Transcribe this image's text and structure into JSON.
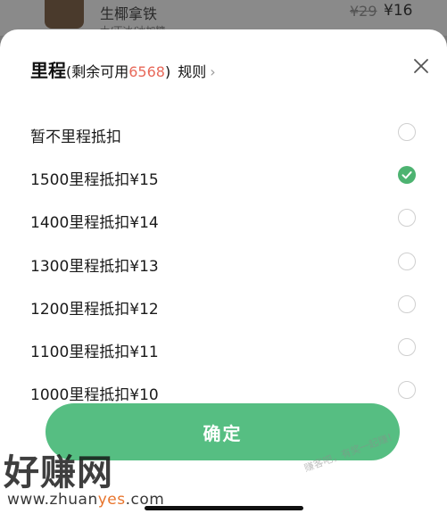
{
  "background_item": {
    "name": "生椰拿铁",
    "subtitle": "大/正冰/冰加糖",
    "original_price": "¥29",
    "price": "¥16"
  },
  "sheet": {
    "title": "里程",
    "remaining_prefix": "(剩余可用",
    "remaining_value": "6568",
    "remaining_suffix": ")",
    "rules_label": "规则",
    "rules_chevron": "›",
    "close_icon": "close-icon",
    "options": [
      {
        "label": "暂不里程抵扣",
        "selected": false
      },
      {
        "label": "1500里程抵扣¥15",
        "selected": true
      },
      {
        "label": "1400里程抵扣¥14",
        "selected": false
      },
      {
        "label": "1300里程抵扣¥13",
        "selected": false
      },
      {
        "label": "1200里程抵扣¥12",
        "selected": false
      },
      {
        "label": "1100里程抵扣¥11",
        "selected": false
      },
      {
        "label": "1000里程抵扣¥10",
        "selected": false
      }
    ],
    "confirm_label": "确定"
  },
  "watermark": {
    "brand": "好赚网",
    "url_prefix": "www.zhuan",
    "url_accent": "yes",
    "url_suffix": ".com",
    "slogan": "赚客吧，有奖一起赚！"
  },
  "colors": {
    "accent_green": "#56be82",
    "check_green": "#4db371",
    "highlight_red": "#e8695a"
  }
}
